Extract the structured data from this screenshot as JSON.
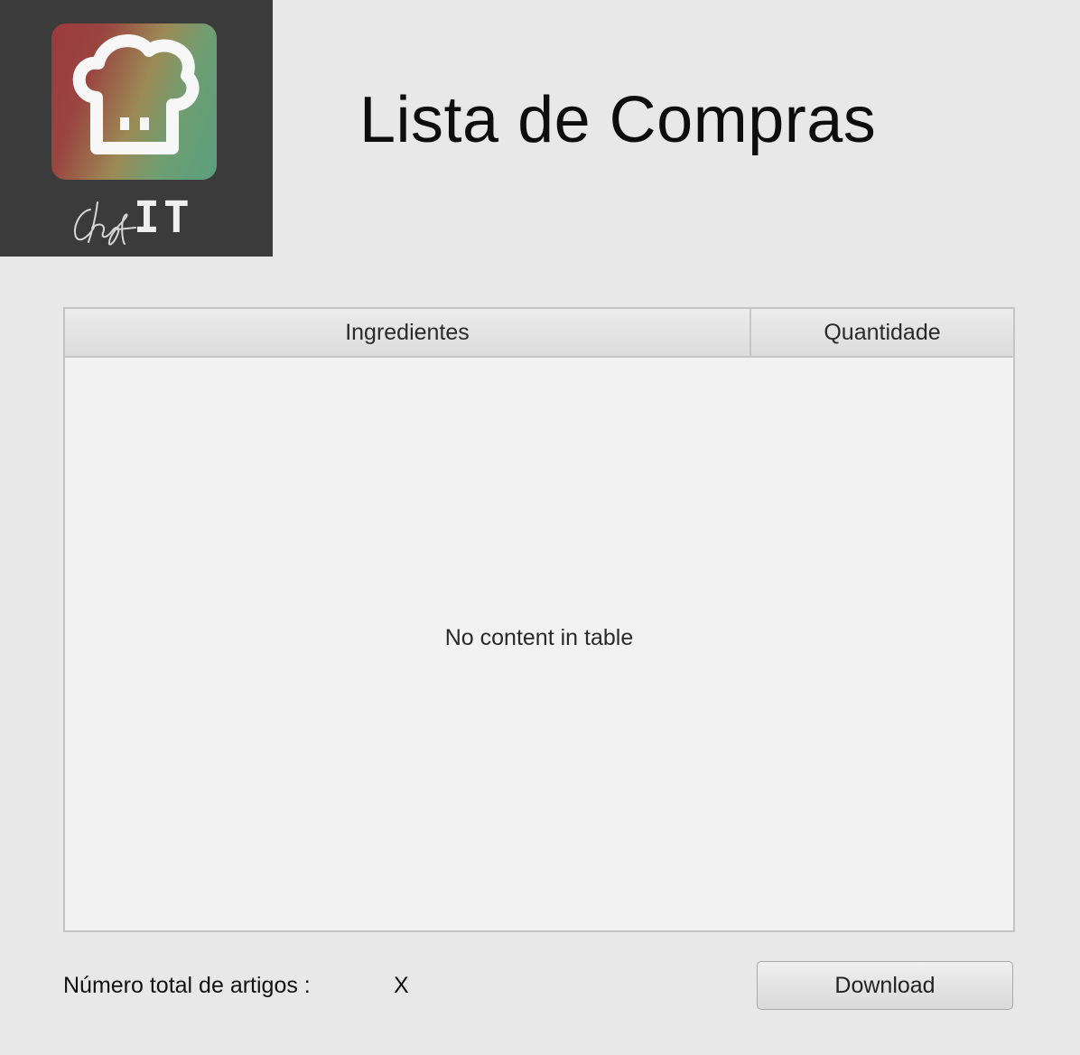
{
  "logo": {
    "icon": "chef-hat-icon",
    "brand_text": "IT",
    "tile_colors": [
      "#9a3a3e",
      "#9b8a56",
      "#5a9f7e"
    ]
  },
  "header": {
    "title": "Lista de Compras"
  },
  "table": {
    "columns": [
      "Ingredientes",
      "Quantidade"
    ],
    "rows": [],
    "empty_message": "No content in table"
  },
  "footer": {
    "total_label": "Número total de artigos :",
    "total_value": "X",
    "download_label": "Download"
  }
}
